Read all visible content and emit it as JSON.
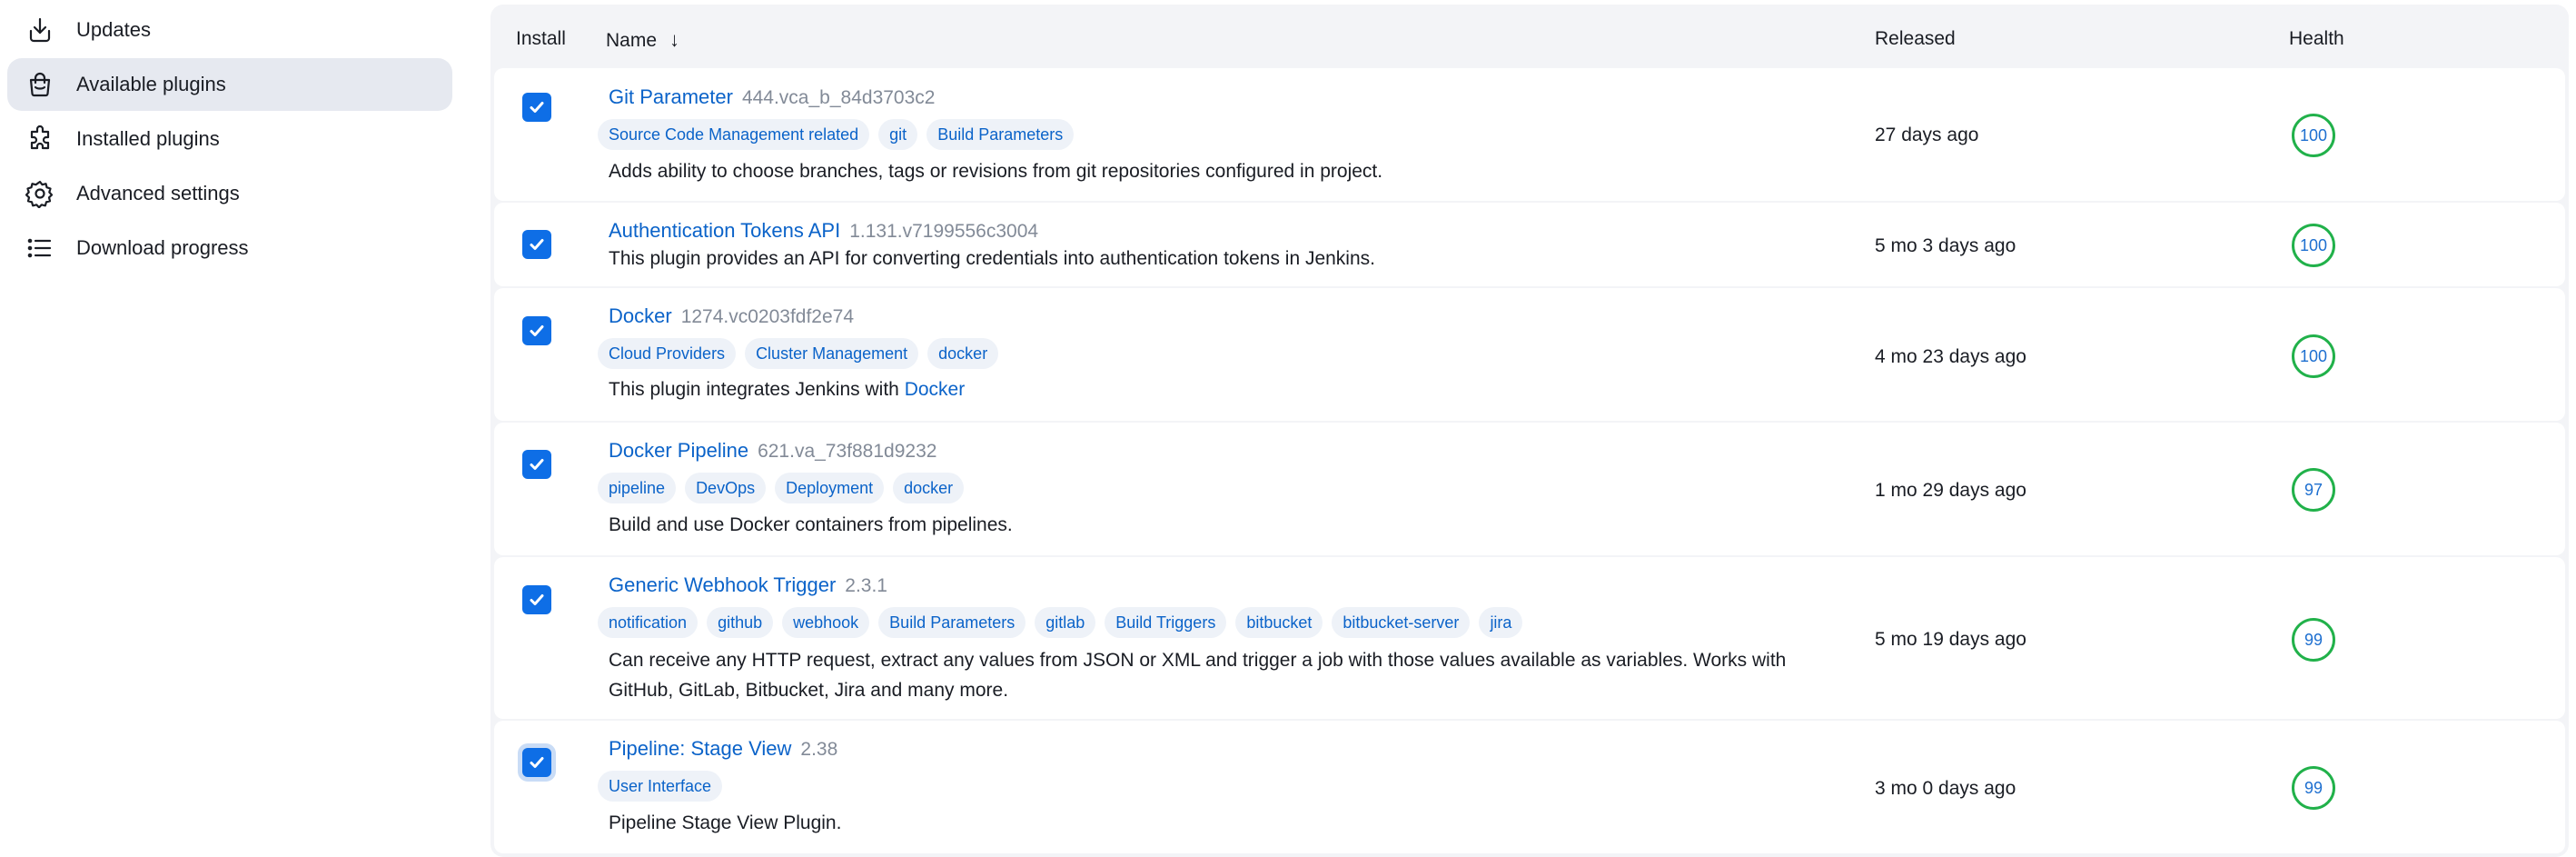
{
  "sidebar": {
    "items": [
      {
        "label": "Updates",
        "icon": "download-icon"
      },
      {
        "label": "Available plugins",
        "icon": "shopping-bag-icon"
      },
      {
        "label": "Installed plugins",
        "icon": "puzzle-icon"
      },
      {
        "label": "Advanced settings",
        "icon": "gear-icon"
      },
      {
        "label": "Download progress",
        "icon": "list-icon"
      }
    ],
    "active_index": 1
  },
  "table": {
    "headers": {
      "install": "Install",
      "name": "Name",
      "sort_indicator": "↓",
      "released": "Released",
      "health": "Health"
    },
    "rows": [
      {
        "checked": true,
        "name": "Git Parameter",
        "version": "444.vca_b_84d3703c2",
        "tags": [
          "Source Code Management related",
          "git",
          "Build Parameters"
        ],
        "description": "Adds ability to choose branches, tags or revisions from git repositories configured in project.",
        "released": "27 days ago",
        "health": "100"
      },
      {
        "checked": true,
        "name": "Authentication Tokens API",
        "version": "1.131.v7199556c3004",
        "tags": [],
        "description": "This plugin provides an API for converting credentials into authentication tokens in Jenkins.",
        "released": "5 mo 3 days ago",
        "health": "100"
      },
      {
        "checked": true,
        "name": "Docker",
        "version": "1274.vc0203fdf2e74",
        "tags": [
          "Cloud Providers",
          "Cluster Management",
          "docker"
        ],
        "description": "This plugin integrates Jenkins with",
        "description_link": "Docker",
        "released": "4 mo 23 days ago",
        "health": "100"
      },
      {
        "checked": true,
        "name": "Docker Pipeline",
        "version": "621.va_73f881d9232",
        "tags": [
          "pipeline",
          "DevOps",
          "Deployment",
          "docker"
        ],
        "description": "Build and use Docker containers from pipelines.",
        "released": "1 mo 29 days ago",
        "health": "97"
      },
      {
        "checked": true,
        "name": "Generic Webhook Trigger",
        "version": "2.3.1",
        "tags": [
          "notification",
          "github",
          "webhook",
          "Build Parameters",
          "gitlab",
          "Build Triggers",
          "bitbucket",
          "bitbucket-server",
          "jira"
        ],
        "description": "Can receive any HTTP request, extract any values from JSON or XML and trigger a job with those values available as variables. Works with",
        "description_line2": "GitHub, GitLab, Bitbucket, Jira and many more.",
        "released": "5 mo 19 days ago",
        "health": "99"
      },
      {
        "checked": true,
        "name": "Pipeline: Stage View",
        "version": "2.38",
        "tags": [
          "User Interface"
        ],
        "description": "Pipeline Stage View Plugin.",
        "released": "3 mo 0 days ago",
        "health": "99"
      }
    ]
  },
  "colors": {
    "accent": "#0e6ee6",
    "link": "#0b63c9",
    "health_ring": "#21b14a",
    "active_sidebar_bg": "#e6e9f0"
  }
}
